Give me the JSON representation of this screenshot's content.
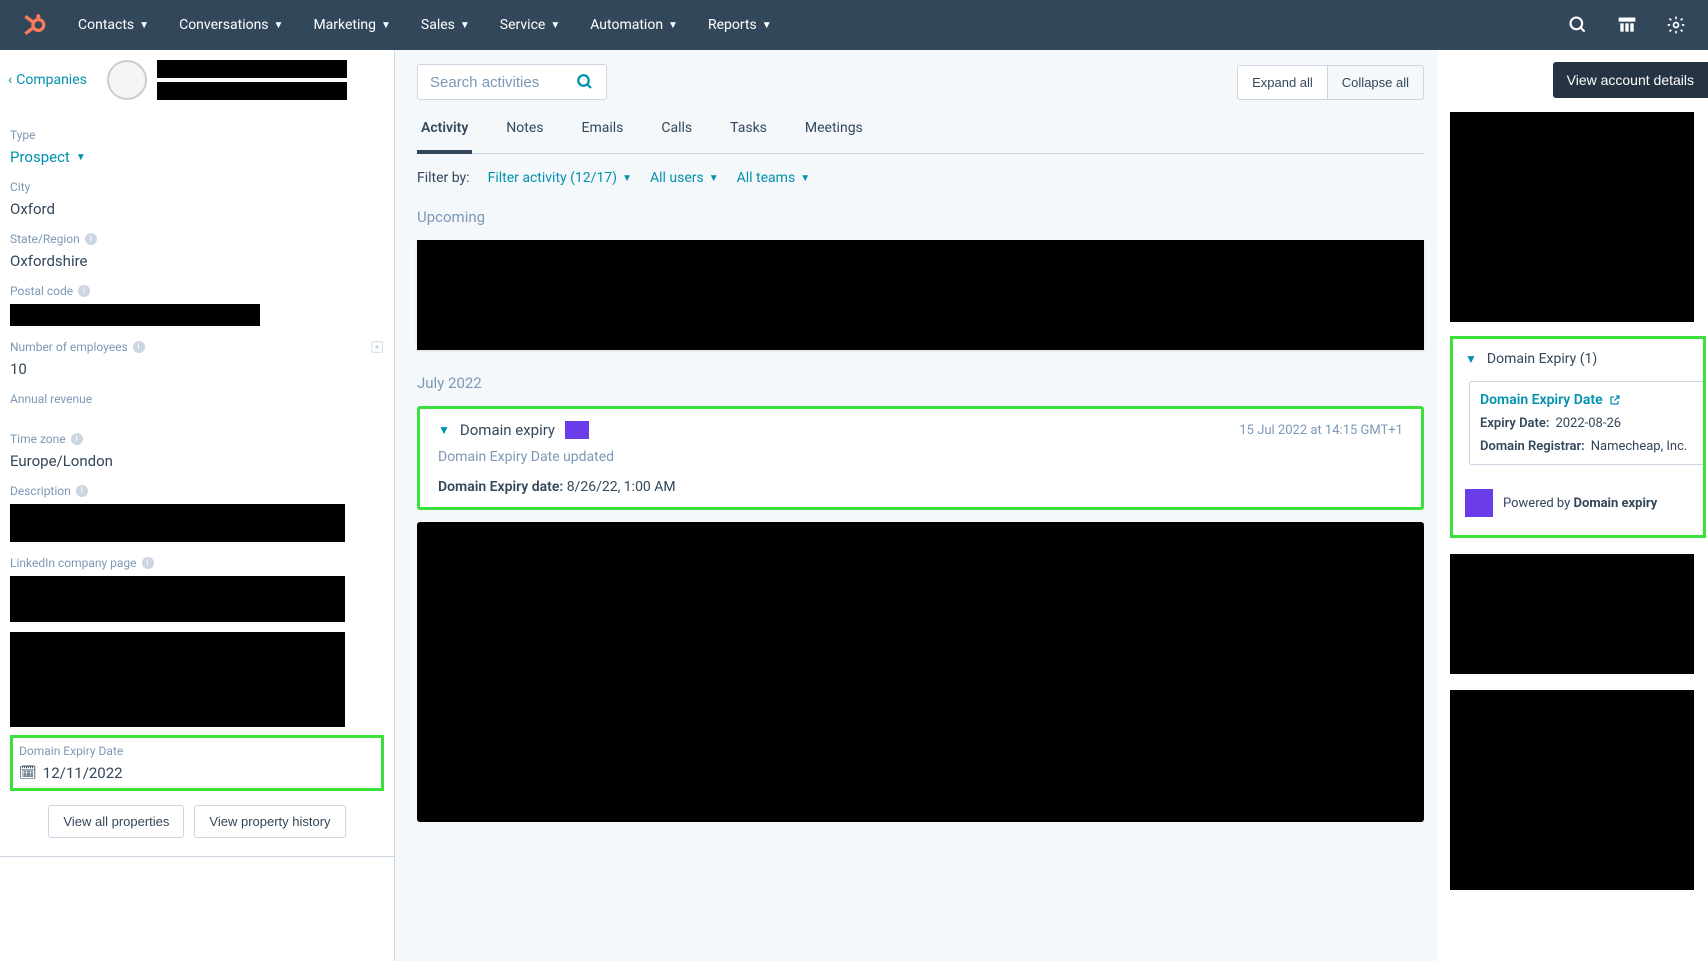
{
  "topnav": {
    "items": [
      "Contacts",
      "Conversations",
      "Marketing",
      "Sales",
      "Service",
      "Automation",
      "Reports"
    ]
  },
  "left": {
    "back": "Companies",
    "props": {
      "type_label": "Type",
      "type_value": "Prospect",
      "city_label": "City",
      "city_value": "Oxford",
      "state_label": "State/Region",
      "state_value": "Oxfordshire",
      "postal_label": "Postal code",
      "employees_label": "Number of employees",
      "employees_value": "10",
      "revenue_label": "Annual revenue",
      "timezone_label": "Time zone",
      "timezone_value": "Europe/London",
      "description_label": "Description",
      "linkedin_label": "LinkedIn company page",
      "domain_expiry_label": "Domain Expiry Date",
      "domain_expiry_value": "12/11/2022"
    },
    "view_all": "View all properties",
    "view_history": "View property history"
  },
  "middle": {
    "search_placeholder": "Search activities",
    "expand_all": "Expand all",
    "collapse_all": "Collapse all",
    "tabs": [
      "Activity",
      "Notes",
      "Emails",
      "Calls",
      "Tasks",
      "Meetings"
    ],
    "filter_by": "Filter by:",
    "filter_activity": "Filter activity (12/17)",
    "all_users": "All users",
    "all_teams": "All teams",
    "upcoming": "Upcoming",
    "month": "July 2022",
    "activity": {
      "title": "Domain expiry",
      "timestamp": "15 Jul 2022 at 14:15 GMT+1",
      "subtitle": "Domain Expiry Date updated",
      "detail_label": "Domain Expiry date:",
      "detail_value": "8/26/22, 1:00 AM"
    }
  },
  "right": {
    "view_account": "View account details",
    "section_title": "Domain Expiry (1)",
    "card_link": "Domain Expiry Date",
    "expiry_label": "Expiry Date:",
    "expiry_value": "2022-08-26",
    "registrar_label": "Domain Registrar:",
    "registrar_value": "Namecheap, Inc.",
    "powered_by": "Powered by ",
    "powered_name": "Domain expiry"
  }
}
